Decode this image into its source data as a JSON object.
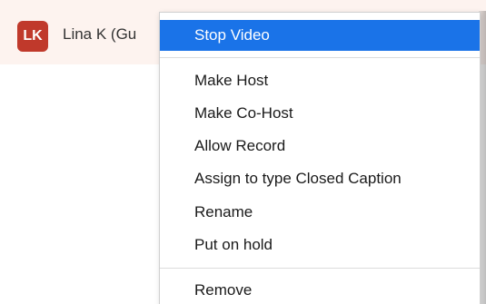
{
  "participant": {
    "initials": "LK",
    "name": "Lina K (Gu"
  },
  "colors": {
    "avatar_bg": "#c0392b",
    "row_bg": "#fdf3ef",
    "highlight": "#1a73e8"
  },
  "menu": {
    "items": [
      {
        "label": "Stop Video",
        "highlighted": true
      },
      {
        "label": "Make Host"
      },
      {
        "label": "Make Co-Host"
      },
      {
        "label": "Allow Record"
      },
      {
        "label": "Assign to type Closed Caption"
      },
      {
        "label": "Rename"
      },
      {
        "label": "Put on hold"
      },
      {
        "label": "Remove"
      }
    ]
  }
}
